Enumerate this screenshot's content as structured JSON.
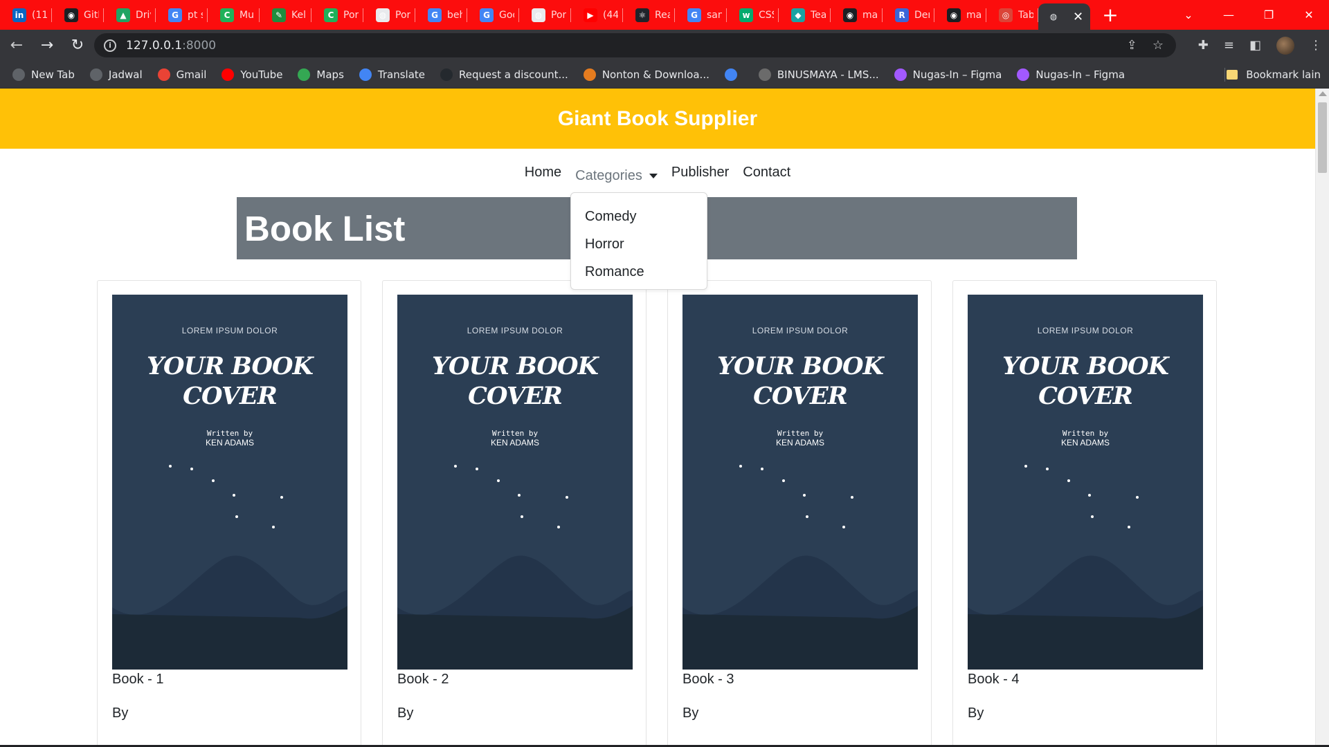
{
  "tabs": [
    {
      "title": "(11",
      "icon": "linkedin-icon",
      "color": "#0a66c2",
      "glyph": "in"
    },
    {
      "title": "GitHub",
      "icon": "github-icon",
      "color": "#1b1f23",
      "glyph": "◉"
    },
    {
      "title": "Drive",
      "icon": "drive-icon",
      "color": "#1fa463",
      "glyph": "▲"
    },
    {
      "title": "pt s",
      "icon": "google-icon",
      "color": "#4285f4",
      "glyph": "G"
    },
    {
      "title": "Mul",
      "icon": "c-icon",
      "color": "#20b15a",
      "glyph": "C"
    },
    {
      "title": "Kel",
      "icon": "classroom-icon",
      "color": "#1e8e3e",
      "glyph": "✎"
    },
    {
      "title": "Por",
      "icon": "c-icon",
      "color": "#20b15a",
      "glyph": "C"
    },
    {
      "title": "Por",
      "icon": "globe-icon",
      "color": "#e8eaed",
      "glyph": "◍"
    },
    {
      "title": "beh",
      "icon": "google-icon",
      "color": "#4285f4",
      "glyph": "G"
    },
    {
      "title": "Goo",
      "icon": "translate-icon",
      "color": "#4285f4",
      "glyph": "G"
    },
    {
      "title": "Por",
      "icon": "globe-icon",
      "color": "#e8eaed",
      "glyph": "◍"
    },
    {
      "title": "(44",
      "icon": "youtube-icon",
      "color": "#ff0000",
      "glyph": "▶"
    },
    {
      "title": "Rea",
      "icon": "react-icon",
      "color": "#20232a",
      "glyph": "⚛"
    },
    {
      "title": "san",
      "icon": "google-icon",
      "color": "#4285f4",
      "glyph": "G"
    },
    {
      "title": "CSS",
      "icon": "w3schools-icon",
      "color": "#04aa6d",
      "glyph": "w"
    },
    {
      "title": "Tea",
      "icon": "diamond-icon",
      "color": "#1aa3a3",
      "glyph": "◆"
    },
    {
      "title": "ma",
      "icon": "github-icon",
      "color": "#1b1f23",
      "glyph": "◉"
    },
    {
      "title": "Der",
      "icon": "r-icon",
      "color": "#3a66d8",
      "glyph": "R"
    },
    {
      "title": "ma",
      "icon": "github-icon",
      "color": "#1b1f23",
      "glyph": "◉"
    },
    {
      "title": "Tab",
      "icon": "chrome-icon",
      "color": "#db4437",
      "glyph": "◎"
    }
  ],
  "browser": {
    "url_host": "127.0.0.1",
    "url_port": ":8000",
    "new_tab_glyph": "+",
    "close_glyph": "✕"
  },
  "bookmarks": [
    {
      "label": "New Tab",
      "icon": "globe-icon",
      "color": "#5f6368"
    },
    {
      "label": "Jadwal",
      "icon": "globe-icon",
      "color": "#5f6368"
    },
    {
      "label": "Gmail",
      "icon": "gmail-icon",
      "color": "#ea4335"
    },
    {
      "label": "YouTube",
      "icon": "youtube-icon",
      "color": "#ff0000"
    },
    {
      "label": "Maps",
      "icon": "maps-icon",
      "color": "#34a853"
    },
    {
      "label": "Translate",
      "icon": "translate-icon",
      "color": "#4285f4"
    },
    {
      "label": "Request a discount...",
      "icon": "github-icon",
      "color": "#24292e"
    },
    {
      "label": "Nonton & Downloa...",
      "icon": "pinwheel-icon",
      "color": "#e57c1f"
    },
    {
      "label": "",
      "icon": "google-icon",
      "color": "#4285f4"
    },
    {
      "label": "BINUSMAYA - LMS...",
      "icon": "binus-icon",
      "color": "#6b6b6b"
    },
    {
      "label": "Nugas-In – Figma",
      "icon": "figma-icon",
      "color": "#a259ff"
    },
    {
      "label": "Nugas-In – Figma",
      "icon": "figma-icon",
      "color": "#a259ff"
    }
  ],
  "bookmark_other": "Bookmark lain",
  "site": {
    "title": "Giant Book Supplier",
    "nav": {
      "home": "Home",
      "categories": "Categories",
      "publisher": "Publisher",
      "contact": "Contact"
    },
    "categories_menu": [
      "Comedy",
      "Horror",
      "Romance"
    ],
    "banner_title": "Book List",
    "accent_color": "#ffc107",
    "banner_color": "#6c757d"
  },
  "cover": {
    "top_text": "LOREM IPSUM DOLOR",
    "title_line1": "YOUR BOOK",
    "title_line2": "COVER",
    "written_by": "Written by",
    "author": "KEN ADAMS"
  },
  "books": [
    {
      "title": "Book - 1",
      "by": "By"
    },
    {
      "title": "Book - 2",
      "by": "By"
    },
    {
      "title": "Book - 3",
      "by": "By"
    },
    {
      "title": "Book - 4",
      "by": "By"
    }
  ]
}
